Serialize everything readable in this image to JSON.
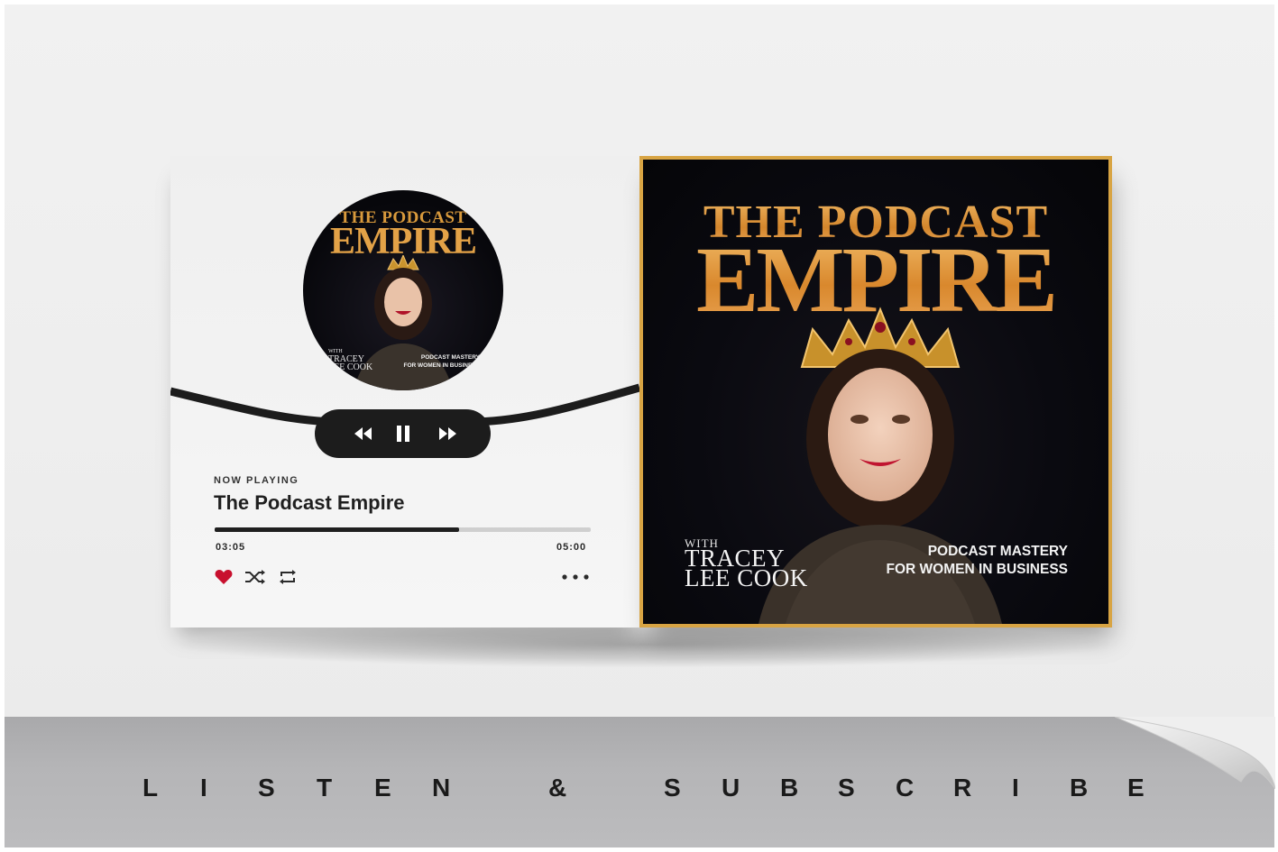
{
  "player": {
    "mini_art": {
      "title_line1": "THE PODCAST",
      "title_line2": "EMPIRE",
      "with_label": "WITH",
      "host_line1": "TRACEY",
      "host_line2": "LEE COOK",
      "tagline_line1": "PODCAST MASTERY",
      "tagline_line2": "FOR WOMEN IN BUSINESS"
    },
    "now_playing_label": "NOW PLAYING",
    "track_title": "The Podcast Empire",
    "current_time": "03:05",
    "total_time": "05:00",
    "progress": 0.65,
    "controls": [
      "rewind-icon",
      "pause-icon",
      "fast-forward-icon"
    ],
    "actions": [
      "heart-icon",
      "shuffle-icon",
      "repeat-icon",
      "more-icon"
    ],
    "colors": {
      "heart": "#c8102e",
      "panel": "#f2f2f2",
      "controls_bg": "#1c1c1c"
    }
  },
  "cover": {
    "title_line1": "THE PODCAST",
    "title_line2": "EMPIRE",
    "with_label": "WITH",
    "host_line1": "TRACEY",
    "host_line2": "LEE COOK",
    "tagline_line1": "PODCAST MASTERY",
    "tagline_line2": "FOR WOMEN IN BUSINESS",
    "colors": {
      "frame": "#d8a443",
      "title_gold": "#e3a247",
      "background": "#0a0a10"
    }
  },
  "footer": {
    "tagline": "LISTEN & SUBSCRIBE"
  }
}
